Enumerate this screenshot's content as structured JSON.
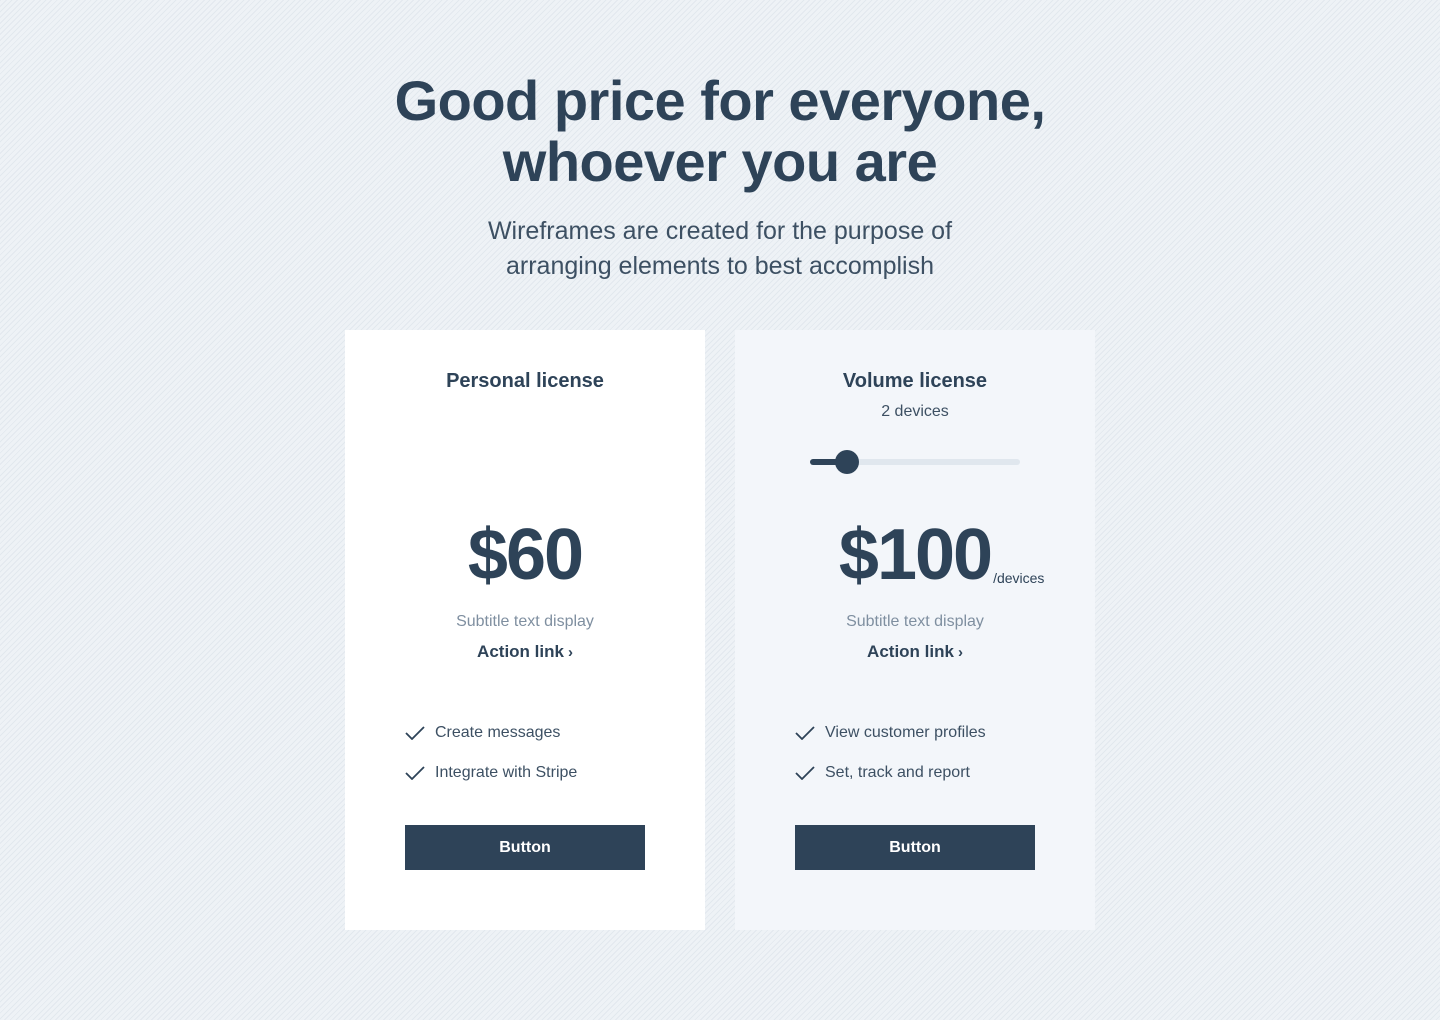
{
  "hero": {
    "title_line1": "Good price for everyone,",
    "title_line2": "whoever you are",
    "subtitle": "Wireframes are created for the purpose of arranging elements to best accomplish"
  },
  "colors": {
    "primary": "#2e4358",
    "card_personal_bg": "#ffffff",
    "card_volume_bg": "#f3f6fa",
    "muted_text": "#7f8fa0"
  },
  "cards": [
    {
      "title": "Personal license",
      "price": "$60",
      "subtitle": "Subtitle text display",
      "action_link": "Action link",
      "action_icon": "chevron-right-icon",
      "features": [
        {
          "icon": "check-icon",
          "label": "Create messages"
        },
        {
          "icon": "check-icon",
          "label": "Integrate with Stripe"
        }
      ],
      "button_label": "Button"
    },
    {
      "title": "Volume license",
      "devices_label": "2 devices",
      "slider": {
        "min": 1,
        "max": 10,
        "value": 2
      },
      "price": "$100",
      "price_unit": "/devices",
      "subtitle": "Subtitle text display",
      "action_link": "Action link",
      "action_icon": "chevron-right-icon",
      "features": [
        {
          "icon": "check-icon",
          "label": "View customer profiles"
        },
        {
          "icon": "check-icon",
          "label": "Set, track and report"
        }
      ],
      "button_label": "Button"
    }
  ]
}
